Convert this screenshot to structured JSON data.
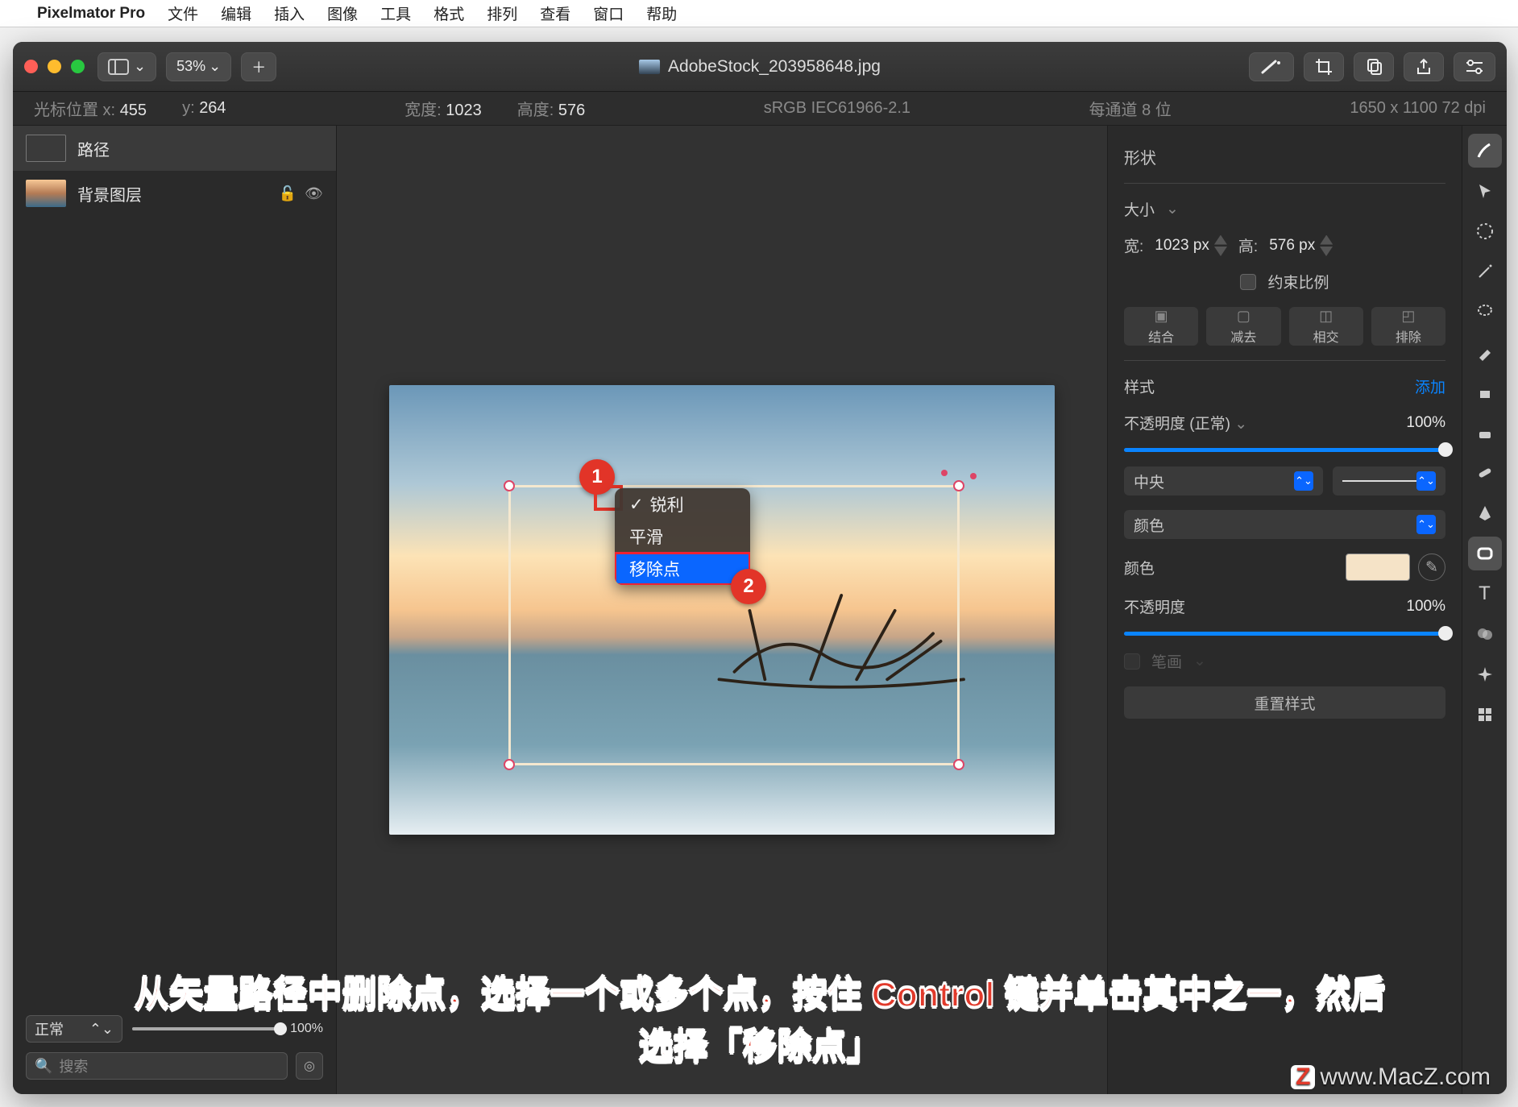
{
  "menubar": {
    "app": "Pixelmator Pro",
    "items": [
      "文件",
      "编辑",
      "插入",
      "图像",
      "工具",
      "格式",
      "排列",
      "查看",
      "窗口",
      "帮助"
    ]
  },
  "titlebar": {
    "zoom": "53%",
    "filename": "AdobeStock_203958648.jpg"
  },
  "infobar": {
    "cursor_label": "光标位置 x:",
    "cursor_x": "455",
    "cursor_y_label": "y:",
    "cursor_y": "264",
    "width_label": "宽度:",
    "width": "1023",
    "height_label": "高度:",
    "height": "576",
    "colorspace": "sRGB IEC61966-2.1",
    "depth": "每通道 8 位",
    "docsize": "1650 x 1100 72 dpi"
  },
  "layers": {
    "items": [
      {
        "name": "路径"
      },
      {
        "name": "背景图层"
      }
    ],
    "blend_mode": "正常",
    "opacity": "100%",
    "search_placeholder": "搜索"
  },
  "context_menu": {
    "sharp": "锐利",
    "smooth": "平滑",
    "remove_point": "移除点"
  },
  "callouts": {
    "one": "1",
    "two": "2"
  },
  "inspector": {
    "shape": "形状",
    "size_label": "大小",
    "width_label": "宽:",
    "width": "1023 px",
    "height_label": "高:",
    "height": "576 px",
    "constrain": "约束比例",
    "ops": {
      "combine": "结合",
      "subtract": "减去",
      "intersect": "相交",
      "exclude": "排除"
    },
    "style_label": "样式",
    "add": "添加",
    "opacity_label_normal": "不透明度 (正常)",
    "opacity_value": "100%",
    "stroke_align": "中央",
    "stroke_color_label": "颜色",
    "fill_color_label": "颜色",
    "opacity_label": "不透明度",
    "opacity_value2": "100%",
    "brush_label": "笔画",
    "reset": "重置样式"
  },
  "caption": {
    "line1": "从矢量路径中删除点，选择一个或多个点，按住 Control 键并单击其中之一，然后",
    "line2": "选择「移除点」"
  },
  "watermark": "www.MacZ.com"
}
